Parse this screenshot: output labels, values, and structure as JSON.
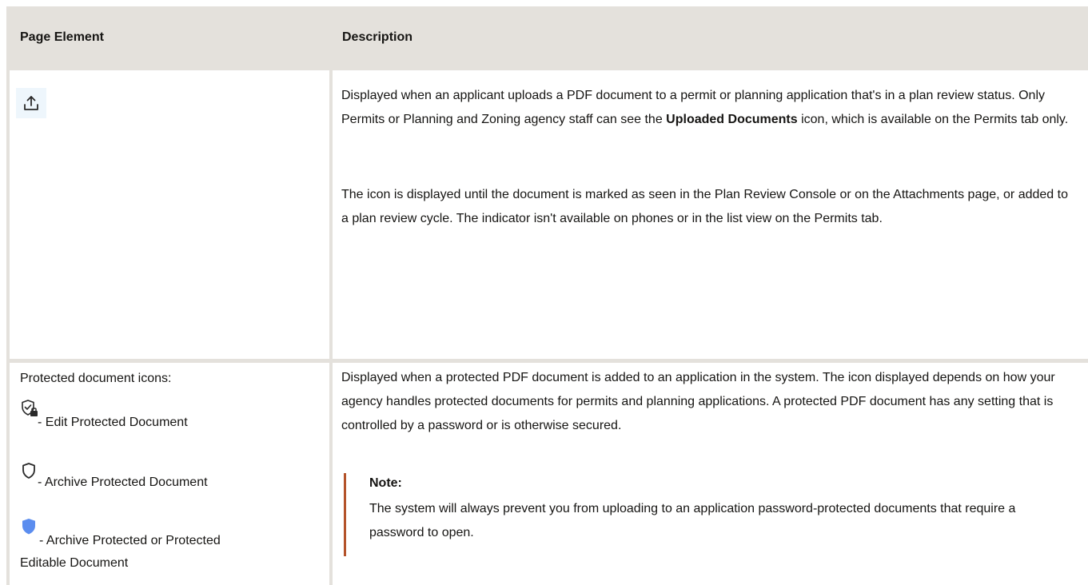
{
  "table": {
    "headers": [
      "Page Element",
      "Description"
    ],
    "rows": [
      {
        "element_icon": "upload-icon",
        "description_paragraphs": [
          {
            "before": "Displayed when an applicant uploads a PDF document to a permit or planning application that's in a plan review status. Only Permits or Planning and Zoning agency staff can see the ",
            "bold": "Uploaded Documents",
            "after": " icon, which is available on the Permits tab only."
          },
          {
            "text": "The icon is displayed until the document is marked as seen in the Plan Review Console or on the Attachments page, or added to a plan review cycle. The indicator isn't available on phones or in the list view on the Permits tab."
          }
        ]
      },
      {
        "element_title": "Protected document icons:",
        "icon_items": [
          {
            "icon": "shield-check-lock-icon",
            "label": "- Edit Protected Document"
          },
          {
            "icon": "shield-outline-icon",
            "label": "- Archive Protected Document"
          },
          {
            "icon": "shield-filled-blue-icon",
            "label": "- Archive Protected or Protected",
            "label_line2": "Editable Document"
          }
        ],
        "description": "Displayed when a protected PDF document is added to an application in the system. The icon displayed depends on how your agency handles protected documents for permits and planning applications. A protected PDF document has any setting that is controlled by a password or is otherwise secured.",
        "note": {
          "title": "Note:",
          "text": "The system will always prevent you from uploading to an application password-protected documents that require a password to open."
        }
      }
    ]
  },
  "colors": {
    "header_bg": "#e4e1dc",
    "note_border": "#b4532a",
    "icon_blue": "#5b8def"
  }
}
